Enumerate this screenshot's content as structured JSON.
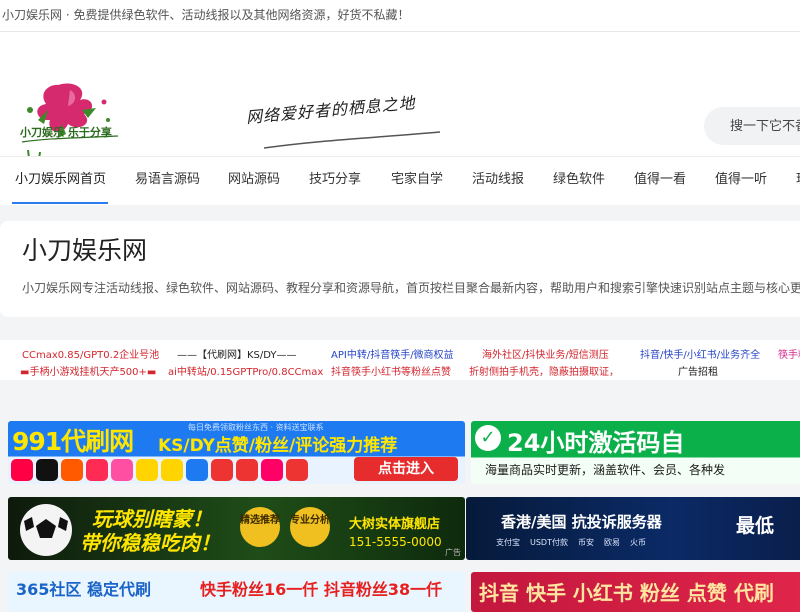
{
  "top_bar": {
    "text": "小刀娱乐网 · 免费提供绿色软件、活动线报以及其他网络资源，好货不私藏！"
  },
  "header": {
    "logo_text": "小刀娱乐 乐于分享",
    "slogan": "网络爱好者的栖息之地",
    "search_placeholder": "搜一下它不香"
  },
  "nav": {
    "items": [
      {
        "label": "小刀娱乐网首页"
      },
      {
        "label": "易语言源码"
      },
      {
        "label": "网站源码"
      },
      {
        "label": "技巧分享"
      },
      {
        "label": "宅家自学"
      },
      {
        "label": "活动线报"
      },
      {
        "label": "绿色软件"
      },
      {
        "label": "值得一看"
      },
      {
        "label": "值得一听"
      },
      {
        "label": "玩"
      }
    ]
  },
  "intro": {
    "title": "小刀娱乐网",
    "description": "小刀娱乐网专注活动线报、绿色软件、网站源码、教程分享和资源导航，首页按栏目聚合最新内容，帮助用户和搜索引擎快速识别站点主题与核心更新。"
  },
  "text_links": {
    "row1": [
      {
        "text": "CCmax0.85/GPT0.2企业号池"
      },
      {
        "text": "——【代刷网】KS/DY——"
      },
      {
        "text": "API中转/抖音筷手/微商权益"
      },
      {
        "text": "海外社区/抖快业务/短信测压"
      },
      {
        "text": "抖音/快手/小红书/业务齐全"
      },
      {
        "text": "筷手粉"
      }
    ],
    "row2": [
      {
        "text": "▬手柄小游戏挂机天产500+▬"
      },
      {
        "text": "ai中转站/0.15GPTPro/0.8CCmax"
      },
      {
        "text": "抖音筷手小红书等粉丝点赞"
      },
      {
        "text": "折射侧拍手机壳，隐蔽拍摄取证，"
      },
      {
        "text": "广告招租"
      }
    ]
  },
  "banners": [
    {
      "title": "991代刷网",
      "subtitle": "KS/DY点赞/粉丝/评论强力推荐",
      "tagline": "每日免费领取粉丝东西 · 资料送宝联系",
      "cta": "点击进入"
    },
    {
      "title": "24小时激活码自",
      "subtitle": "海量商品实时更新，涵盖软件、会员、各种发"
    },
    {
      "title": "玩球别瞎蒙！",
      "subtitle": "带你稳稳吃肉！",
      "badge1": "精选推荐",
      "badge2": "专业分析",
      "shop": "大树实体旗舰店",
      "phone": "151-5555-0000",
      "ad": "广告"
    },
    {
      "title": "香港/美国 抗投诉服务器",
      "price": "最低",
      "pays": [
        "支付宝",
        "USDT付款",
        "币安",
        "欧易",
        "火币"
      ]
    },
    {
      "title": "365社区 稳定代刷",
      "offer": "快手粉丝16一仟  抖音粉丝38一仟"
    },
    {
      "title": "抖音 快手 小红书 粉丝 点赞 代刷"
    }
  ]
}
